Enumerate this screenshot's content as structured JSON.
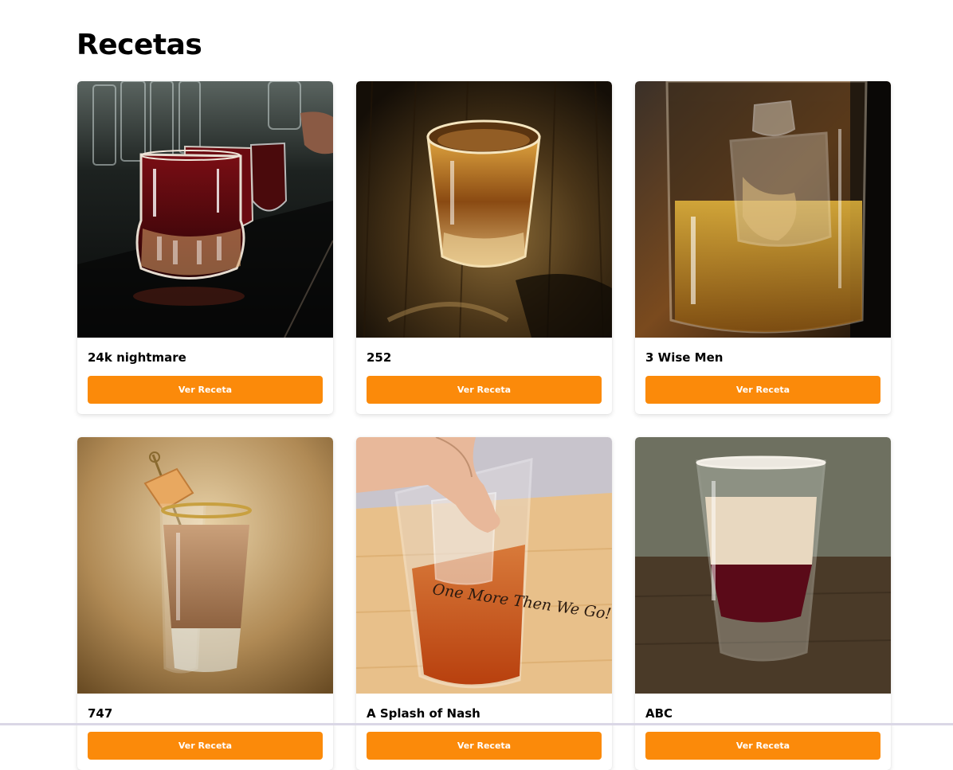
{
  "page": {
    "title": "Recetas"
  },
  "recipes": [
    {
      "name": "24k nightmare",
      "button_label": "Ver Receta"
    },
    {
      "name": "252",
      "button_label": "Ver Receta"
    },
    {
      "name": "3 Wise Men",
      "button_label": "Ver Receta"
    },
    {
      "name": "747",
      "button_label": "Ver Receta"
    },
    {
      "name": "A Splash of Nash",
      "button_label": "Ver Receta"
    },
    {
      "name": "ABC",
      "button_label": "Ver Receta"
    }
  ],
  "image_text": {
    "glass_print": "One More Then We Go!"
  },
  "colors": {
    "accent": "#fb8a0a",
    "background": "#ffffff"
  }
}
